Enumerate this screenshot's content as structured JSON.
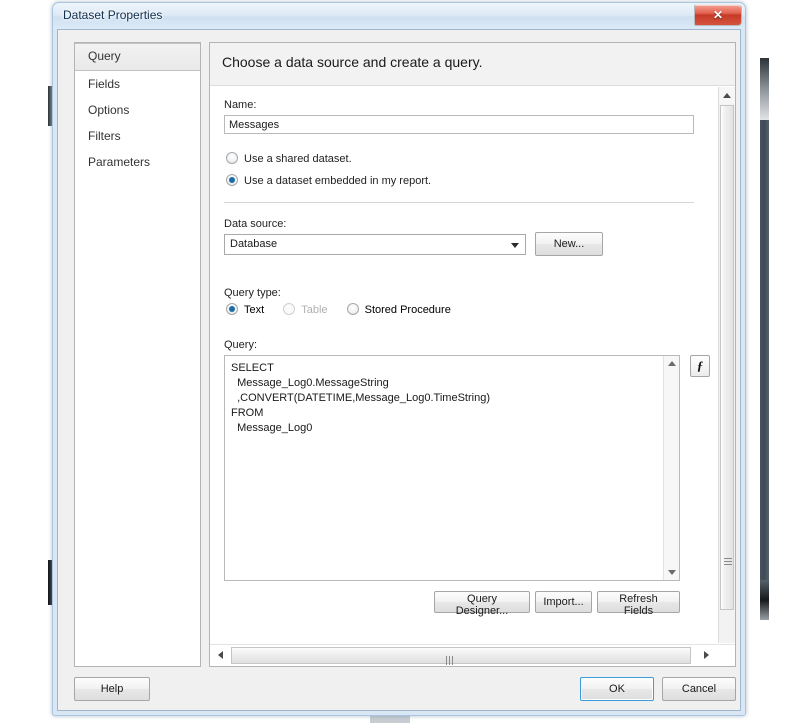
{
  "window": {
    "title": "Dataset Properties",
    "close_label": "✕"
  },
  "sidebar": {
    "items": [
      {
        "label": "Query"
      },
      {
        "label": "Fields"
      },
      {
        "label": "Options"
      },
      {
        "label": "Filters"
      },
      {
        "label": "Parameters"
      }
    ]
  },
  "panel": {
    "header": "Choose a data source and create a query.",
    "name": {
      "label": "Name:",
      "value": "Messages"
    },
    "dataset_source": {
      "shared_label": "Use a shared dataset.",
      "embedded_label": "Use a dataset embedded in my report."
    },
    "data_source": {
      "label": "Data source:",
      "selected": "Database",
      "new_button": "New..."
    },
    "query_type": {
      "label": "Query type:",
      "options": [
        {
          "label": "Text"
        },
        {
          "label": "Table"
        },
        {
          "label": "Stored Procedure"
        }
      ]
    },
    "query": {
      "label": "Query:",
      "text": "SELECT\n  Message_Log0.MessageString\n  ,CONVERT(DATETIME,Message_Log0.TimeString)\nFROM\n  Message_Log0",
      "expression_button": "ƒ"
    },
    "actions": {
      "query_designer": "Query Designer...",
      "import": "Import...",
      "refresh_fields": "Refresh Fields"
    }
  },
  "footer": {
    "help": "Help",
    "ok": "OK",
    "cancel": "Cancel"
  }
}
